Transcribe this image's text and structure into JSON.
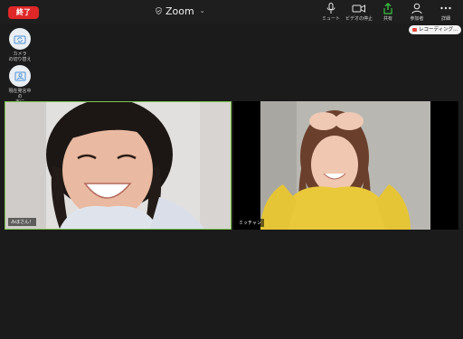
{
  "topbar": {
    "end_label": "終了",
    "title": "Zoom",
    "tools": [
      {
        "label": "ミュート",
        "icon": "microphone-icon"
      },
      {
        "label": "ビデオの停止",
        "icon": "video-camera-icon"
      },
      {
        "label": "共有",
        "icon": "share-icon"
      },
      {
        "label": "参加者",
        "icon": "participants-icon"
      },
      {
        "label": "詳細",
        "icon": "more-icon"
      }
    ]
  },
  "side": {
    "camera_switch_label": "カメラ\nの切り替え",
    "view_switch_label": "現在発言中の\n方に\n切り替える"
  },
  "recording": {
    "label": "レコーディング..."
  },
  "participants": [
    {
      "name": "みほさん！"
    },
    {
      "name": "ミッチャン"
    }
  ],
  "colors": {
    "accent_active_speaker": "#7fc650",
    "end_button": "#e02727",
    "share_icon": "#35c23b"
  }
}
